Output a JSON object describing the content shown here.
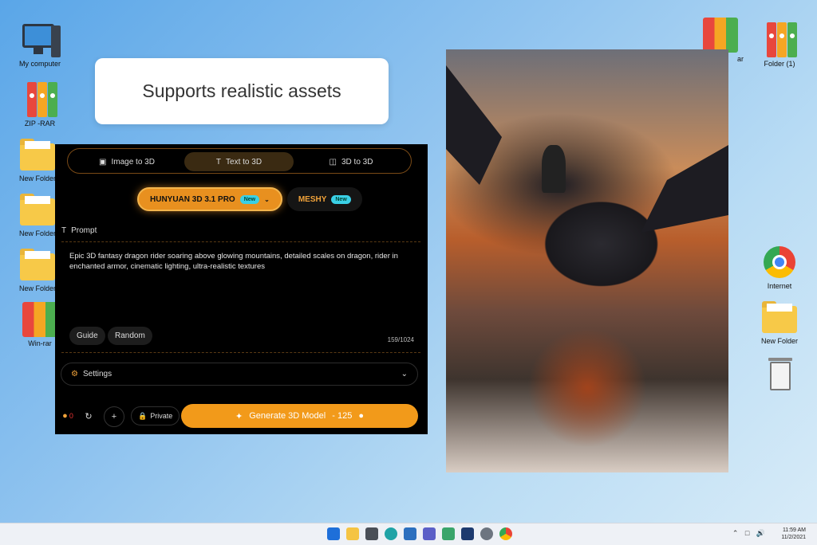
{
  "desktop": {
    "left_icons": [
      {
        "label": "My computer",
        "icon": "computer-icon"
      },
      {
        "label": "ZIP -RAR",
        "icon": "winrar-icon"
      },
      {
        "label": "New Folder",
        "icon": "folder-icon"
      },
      {
        "label": "New Folder",
        "icon": "folder-icon"
      },
      {
        "label": "New Folder",
        "icon": "folder-icon"
      },
      {
        "label": "Win-rar",
        "icon": "winrar-icon"
      }
    ],
    "right_icons": [
      {
        "label": "ar",
        "icon": "winrar-icon"
      },
      {
        "label": "Folder (1)",
        "icon": "winrar-icon"
      },
      {
        "label": "Internet",
        "icon": "chrome-icon"
      },
      {
        "label": "New Folder",
        "icon": "folder-icon"
      },
      {
        "label": "",
        "icon": "recycle-bin-icon"
      }
    ]
  },
  "banner": {
    "text": "Supports realistic assets"
  },
  "panel": {
    "tabs": [
      {
        "label": "Image to 3D",
        "icon": "image-icon",
        "active": false
      },
      {
        "label": "Text to 3D",
        "icon": "text-icon",
        "active": true
      },
      {
        "label": "3D to 3D",
        "icon": "cube-icon",
        "active": false
      }
    ],
    "models": [
      {
        "label": "HUNYUAN 3D  3.1 PRO",
        "badge": "New",
        "selected": true
      },
      {
        "label": "MESHY",
        "badge": "New",
        "selected": false
      }
    ],
    "prompt": {
      "label": "Prompt",
      "text": "Epic 3D fantasy dragon rider soaring above glowing mountains, detailed scales on dragon, rider in enchanted armor, cinematic lighting, ultra-realistic textures",
      "counter": "159/1024",
      "buttons": [
        "Guide",
        "Random"
      ]
    },
    "settings": {
      "label": "Settings"
    },
    "bottom": {
      "credits": "0",
      "private_label": "Private",
      "generate_label": "Generate 3D Model",
      "generate_cost": "- 125"
    },
    "accent_color": "#f29a1a"
  },
  "taskbar": {
    "apps": [
      "start-icon",
      "file-explorer-icon",
      "camera-icon",
      "edge-icon",
      "store-icon",
      "teams-icon",
      "maps-icon",
      "app-icon",
      "settings-icon",
      "chrome-icon"
    ],
    "time": "11:59 AM",
    "date": "11/2/2021"
  }
}
